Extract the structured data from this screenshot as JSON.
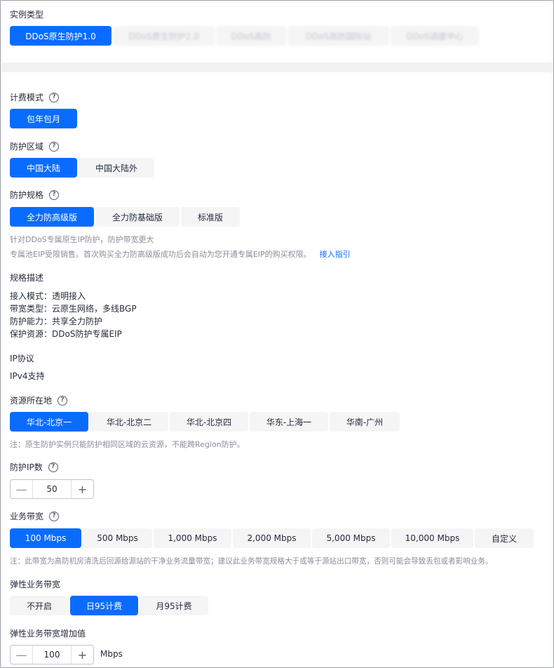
{
  "colors": {
    "primary": "#0a6cff",
    "segment_bg": "#f5f5f6",
    "hint": "#8a8e99"
  },
  "instance_type": {
    "label": "实例类型",
    "options": [
      "DDoS原生防护1.0",
      "DDoS原生防护2.0",
      "DDoS高防",
      "DDoS高防国际站",
      "DDoS调度中心"
    ]
  },
  "billing": {
    "label": "计费模式",
    "options": [
      "包年包月"
    ]
  },
  "region_scope": {
    "label": "防护区域",
    "options": [
      "中国大陆",
      "中国大陆外"
    ]
  },
  "spec": {
    "label": "防护规格",
    "options": [
      "全力防高级版",
      "全力防基础版",
      "标准版"
    ],
    "hint1": "针对DDoS专属原生IP防护，防护带宽更大",
    "hint2": "专属池EIP受限销售。首次购买全力防高级版成功后会自动为您开通专属EIP的购买权限。",
    "hint2_link": "接入指引"
  },
  "spec_desc": {
    "label": "规格描述",
    "lines": [
      "接入模式：透明接入",
      "带宽类型：云原生网络，多线BGP",
      "防护能力：共享全力防护",
      "保护资源：DDoS防护专属EIP"
    ]
  },
  "ip_protocol": {
    "label": "IP协议",
    "value": "IPv4支持"
  },
  "location": {
    "label": "资源所在地",
    "options": [
      "华北-北京一",
      "华北-北京二",
      "华北-北京四",
      "华东-上海一",
      "华南-广州"
    ],
    "hint": "注：原生防护实例只能防护相同区域的云资源，不能跨Region防护。"
  },
  "ip_count": {
    "label": "防护IP数",
    "value": "50"
  },
  "bandwidth": {
    "label": "业务带宽",
    "options": [
      "100 Mbps",
      "500 Mbps",
      "1,000 Mbps",
      "2,000 Mbps",
      "5,000 Mbps",
      "10,000 Mbps",
      "自定义"
    ],
    "hint": "注：此带宽为高防机房清洗后回源给源站的干净业务流量带宽；建议此业务带宽规格大于或等于源站出口带宽，否则可能会导致丢包或者影响业务。"
  },
  "elastic": {
    "label": "弹性业务带宽",
    "options": [
      "不开启",
      "日95计费",
      "月95计费"
    ]
  },
  "elastic_increment": {
    "label": "弹性业务带宽增加值",
    "value": "100",
    "unit": "Mbps"
  },
  "icons": {
    "help": "question-circle-icon",
    "minus": "minus-icon",
    "plus": "plus-icon"
  }
}
